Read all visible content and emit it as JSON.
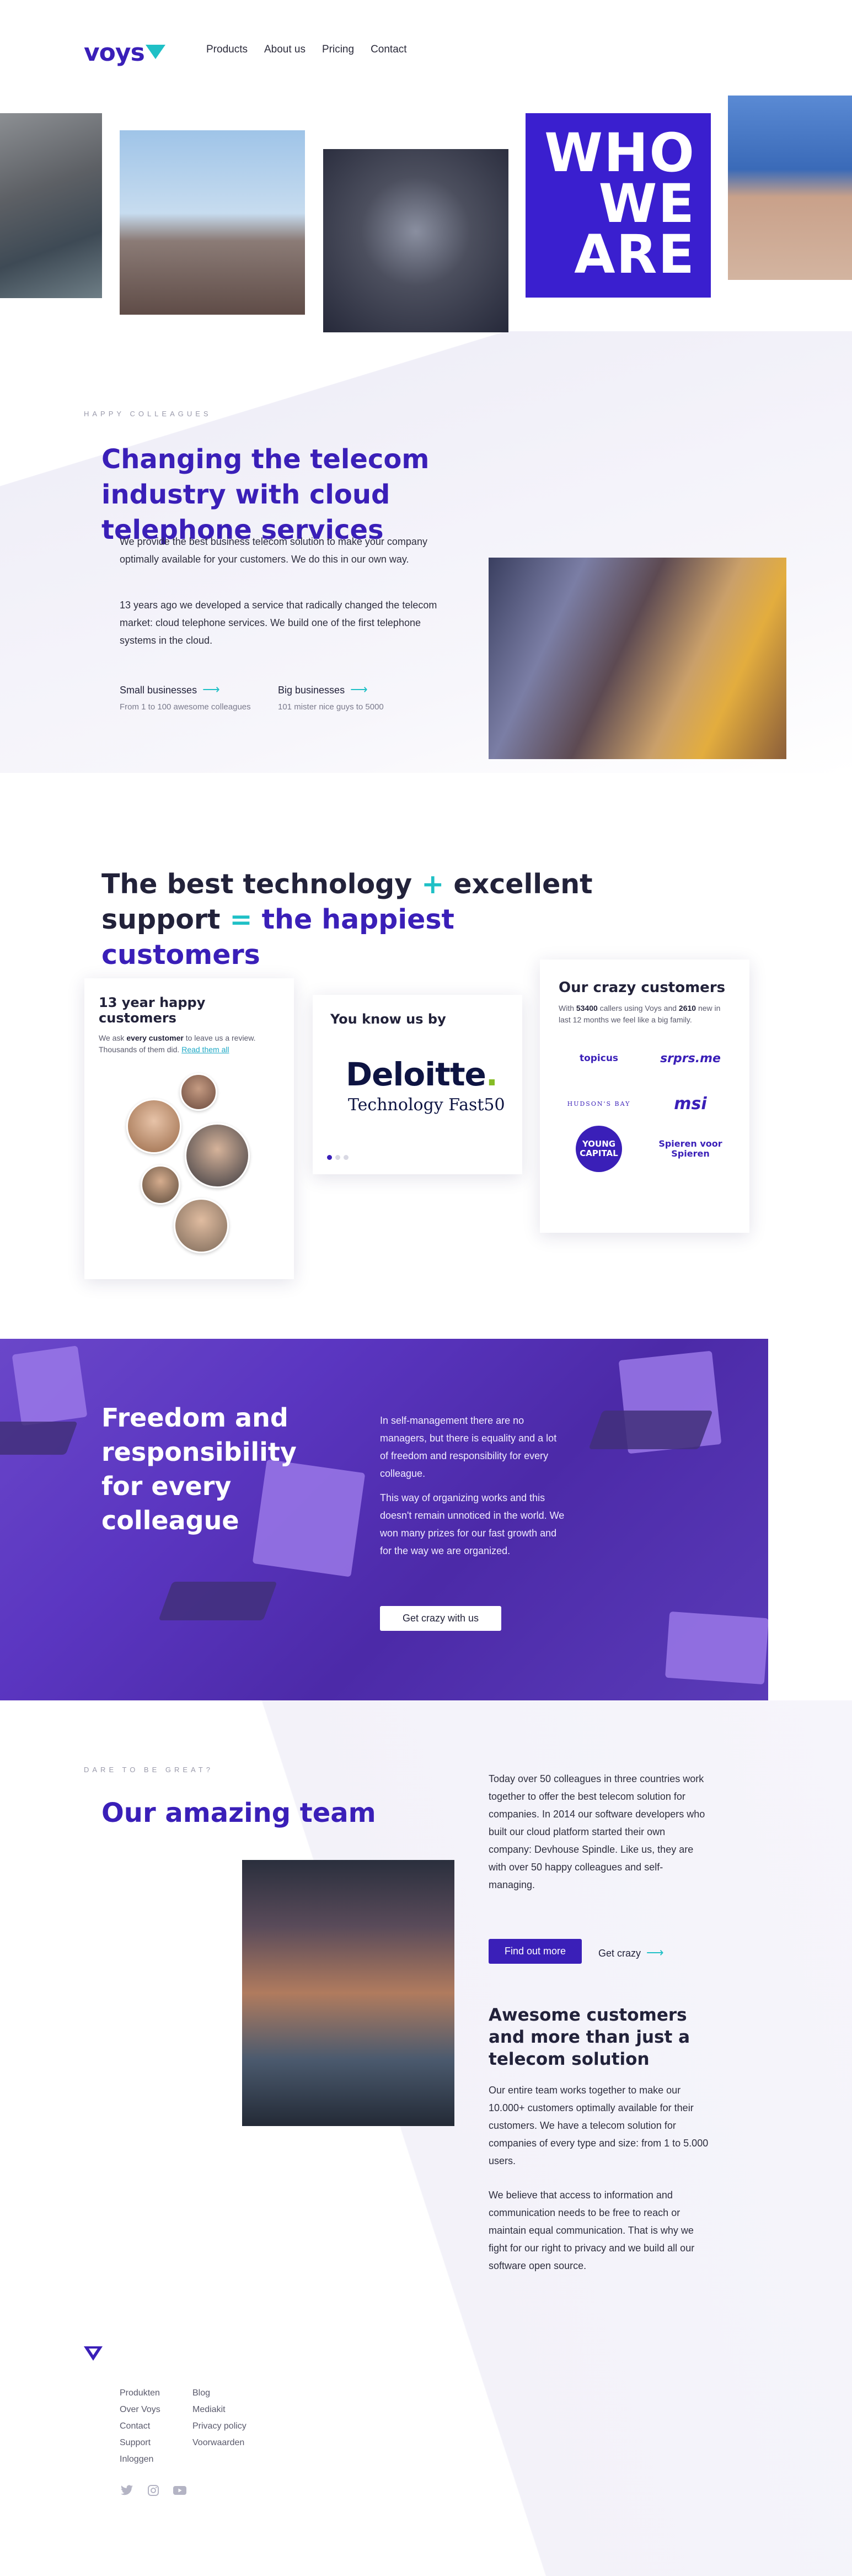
{
  "brand": {
    "logo_text": "voys"
  },
  "nav": {
    "items": [
      "Products",
      "About us",
      "Pricing",
      "Contact"
    ]
  },
  "hero": {
    "who_lines": [
      "WHO",
      "WE",
      "ARE"
    ]
  },
  "section_colleagues": {
    "eyebrow": "HAPPY COLLEAGUES",
    "title": "Changing the telecom industry with cloud telephone services",
    "p1": "We provide the best business telecom solution to make your company optimally available for your customers. We do this in our own way.",
    "p2": "13 years ago we developed a service that radically changed the telecom market: cloud telephone services. We build one of the first telephone systems in the cloud.",
    "links": [
      {
        "label": "Small businesses",
        "arrow": "⟶",
        "sub": "From 1 to 100 awesome colleagues"
      },
      {
        "label": "Big businesses",
        "arrow": "⟶",
        "sub": "101 mister nice guys to  5000"
      }
    ]
  },
  "section_tech": {
    "title_part1": "The best technology ",
    "plus": "+",
    "title_part2": " excellent support ",
    "equals": "=",
    "title_part3": " the happiest customers",
    "card1": {
      "title": "13 year happy customers",
      "text_before": "We ask ",
      "text_bold": "every customer",
      "text_after": " to leave us a review. Thousands of them did. ",
      "link": "Read them all"
    },
    "card2": {
      "title": "You know us by",
      "deloitte": "Deloitte",
      "deloitte_dot": ".",
      "fast50": "Technology Fast50"
    },
    "card3": {
      "title": "Our crazy customers",
      "t1": "With ",
      "n1": "53400",
      "t2": " callers using Voys and ",
      "n2": "2610",
      "t3": " new in last 12 months we feel like a big family.",
      "logos": [
        "topicus",
        "srprs.me",
        "HUDSON'S BAY",
        "msi",
        "YOUNG CAPITAL",
        "Spieren voor Spieren"
      ]
    }
  },
  "section_freedom": {
    "title": "Freedom and responsibility for every colleague",
    "p1": "In self-management there are no managers, but there is equality and a lot of freedom and responsibility for every colleague.",
    "p2": "This way of organizing works and this doesn't remain unnoticed in the world. We won many prizes for our fast growth and for the way we are organized.",
    "button": "Get crazy with us"
  },
  "section_team": {
    "eyebrow": "DARE TO BE GREAT?",
    "title": "Our amazing team",
    "p1": "Today over 50 colleagues in three countries work together to offer the best telecom solution for companies. In 2014 our software developers who built our cloud platform started their own company: Devhouse Spindle. Like us, they are with over 50 happy colleagues and self-managing.",
    "button": "Find out more",
    "link": "Get crazy",
    "link_arrow": "⟶",
    "h3": "Awesome customers and more than just a telecom solution",
    "p2": "Our entire team works together to make our 10.000+ customers optimally available for their customers. We have a telecom solution for companies of every type and size: from 1 to 5.000 users.",
    "p3": "We believe that access to information and communication needs to be free to reach or maintain equal communication. That is why we fight for our right to privacy and we build all our software open source."
  },
  "footer": {
    "col1": [
      "Produkten",
      "Over Voys",
      "Contact",
      "Support",
      "Inloggen"
    ],
    "col2": [
      "Blog",
      "Mediakit",
      "Privacy policy",
      "Voorwaarden"
    ],
    "social": [
      "twitter-icon",
      "instagram-icon",
      "youtube-icon"
    ]
  },
  "colors": {
    "brand_purple": "#3a1fb8",
    "accent_teal": "#1fc0c6",
    "deloitte_green": "#86bc25"
  }
}
